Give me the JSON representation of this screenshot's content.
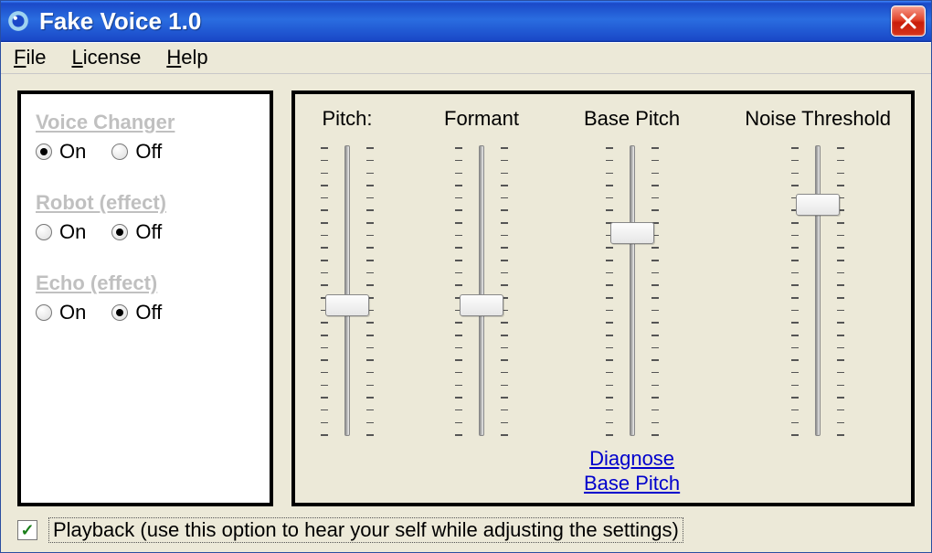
{
  "title": "Fake Voice 1.0",
  "menu": {
    "file": "File",
    "license": "License",
    "help": "Help"
  },
  "left": {
    "voice_changer": {
      "title": "Voice Changer",
      "on": "On",
      "off": "Off",
      "value": "on"
    },
    "robot": {
      "title": "Robot (effect)",
      "on": "On",
      "off": "Off",
      "value": "off"
    },
    "echo": {
      "title": "Echo (effect)",
      "on": "On",
      "off": "Off",
      "value": "off"
    }
  },
  "sliders": {
    "pitch": {
      "label": "Pitch:",
      "value": 45
    },
    "formant": {
      "label": "Formant",
      "value": 45
    },
    "base_pitch": {
      "label": "Base Pitch",
      "value": 70,
      "link1": "Diagnose",
      "link2": "Base Pitch"
    },
    "noise_threshold": {
      "label": "Noise Threshold",
      "value": 80
    }
  },
  "playback": {
    "checked": true,
    "label": "Playback (use this option to hear your self while adjusting the settings)"
  }
}
